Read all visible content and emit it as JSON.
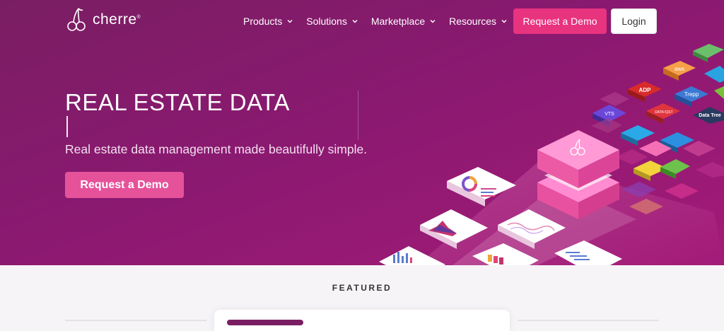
{
  "brand": {
    "name": "cherre",
    "registered": "®"
  },
  "nav": {
    "items": [
      {
        "label": "Products"
      },
      {
        "label": "Solutions"
      },
      {
        "label": "Marketplace"
      },
      {
        "label": "Resources"
      }
    ],
    "request_demo_label": "Request a Demo",
    "login_label": "Login"
  },
  "hero": {
    "headline": "REAL ESTATE DATA",
    "subheadline": "Real estate data management made beautifully simple.",
    "cta_label": "Request a Demo"
  },
  "tiles": {
    "aws": "aws",
    "adp": "ADP",
    "trepp": "Trepp",
    "vts": "VTS",
    "datatree": "Data Tree",
    "dataisst": "DATA IQST"
  },
  "featured": {
    "label": "FEATURED"
  },
  "colors": {
    "accent": "#e8337f",
    "hero_bg": "#8a1970",
    "cta_hero": "#e6529a"
  }
}
